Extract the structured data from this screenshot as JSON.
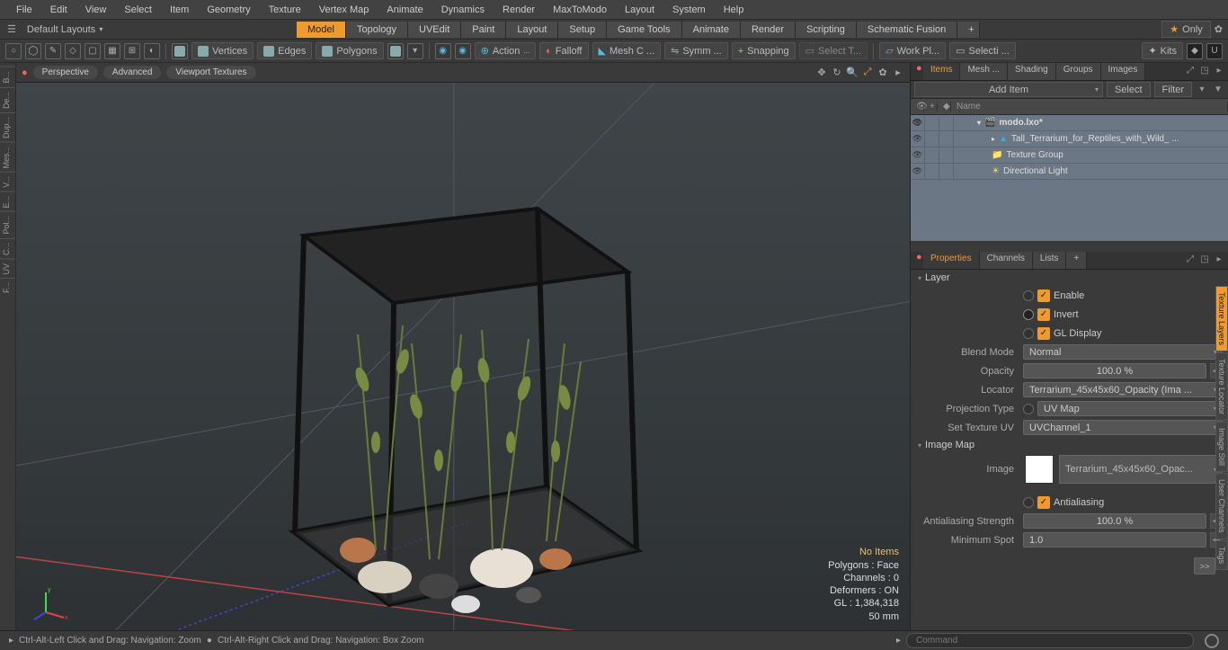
{
  "menubar": [
    "File",
    "Edit",
    "View",
    "Select",
    "Item",
    "Geometry",
    "Texture",
    "Vertex Map",
    "Animate",
    "Dynamics",
    "Render",
    "MaxToModo",
    "Layout",
    "System",
    "Help"
  ],
  "layouts": {
    "default": "Default Layouts"
  },
  "tabs": [
    "Model",
    "Topology",
    "UVEdit",
    "Paint",
    "Layout",
    "Setup",
    "Game Tools",
    "Animate",
    "Render",
    "Scripting",
    "Schematic Fusion"
  ],
  "tabs_active": 0,
  "only_label": "Only",
  "toolbar_buttons": {
    "vertices": "Vertices",
    "edges": "Edges",
    "polygons": "Polygons",
    "action": "Action",
    "falloff": "Falloff",
    "meshc": "Mesh C ...",
    "symm": "Symm ...",
    "snapping": "Snapping",
    "selectt": "Select T...",
    "workpl": "Work Pl...",
    "selecti": "Selecti ...",
    "kits": "Kits"
  },
  "left_tabs": [
    "B...",
    "De...",
    "Dup...",
    "Mes...",
    "V...",
    "E...",
    "Pol...",
    "C...",
    "UV",
    "F..."
  ],
  "viewport_tabs": [
    "Perspective",
    "Advanced",
    "Viewport Textures"
  ],
  "scene_info": {
    "no_items": "No Items",
    "polygons": "Polygons : Face",
    "channels": "Channels : 0",
    "deformers": "Deformers : ON",
    "gl": "GL : 1,384,318",
    "unit": "50 mm"
  },
  "panel1_tabs": [
    "Items",
    "Mesh ...",
    "Shading",
    "Groups",
    "Images"
  ],
  "panel1_active": 0,
  "items_toolbar": {
    "add": "Add Item",
    "select": "Select",
    "filter": "Filter"
  },
  "items_header": "Name",
  "tree": {
    "root": "modo.lxo*",
    "items": [
      "Tall_Terrarium_for_Reptiles_with_Wild_ ...",
      "Texture Group",
      "Directional Light"
    ]
  },
  "panel2_tabs": [
    "Properties",
    "Channels",
    "Lists",
    "+"
  ],
  "panel2_active": 0,
  "prop_groups": {
    "layer": "Layer",
    "image_map": "Image Map"
  },
  "props": {
    "enable": "Enable",
    "invert": "Invert",
    "gl_display": "GL Display",
    "blend_mode": {
      "label": "Blend Mode",
      "value": "Normal"
    },
    "opacity": {
      "label": "Opacity",
      "value": "100.0 %"
    },
    "locator": {
      "label": "Locator",
      "value": "Terrarium_45x45x60_Opacity (Ima ..."
    },
    "projection_type": {
      "label": "Projection Type",
      "value": "UV Map"
    },
    "set_texture_uv": {
      "label": "Set Texture UV",
      "value": "UVChannel_1"
    },
    "image": {
      "label": "Image",
      "value": "Terrarium_45x45x60_Opac..."
    },
    "antialiasing": "Antialiasing",
    "aa_strength": {
      "label": "Antialiasing Strength",
      "value": "100.0 %"
    },
    "min_spot": {
      "label": "Minimum Spot",
      "value": "1.0"
    },
    "go": ">>"
  },
  "edge_tabs": [
    "Texture Layers",
    "Texture Locator",
    "Image Still",
    "User Channels",
    "Tags"
  ],
  "status": {
    "left1": "Ctrl-Alt-Left Click and Drag: Navigation: Zoom",
    "left2": "Ctrl-Alt-Right Click and Drag: Navigation: Box Zoom",
    "command_placeholder": "Command"
  }
}
